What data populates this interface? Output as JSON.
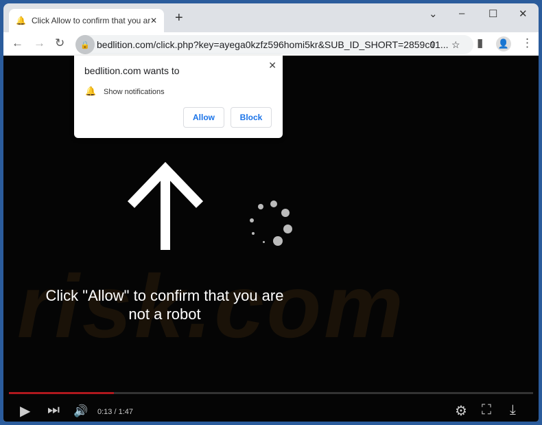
{
  "tab": {
    "title": "Click Allow to confirm that you are not a robot",
    "icon": "bell-favicon-icon"
  },
  "address": {
    "url": "bedlition.com/click.php?key=ayega0kzfz596homi5kr&SUB_ID_SHORT=2859c01..."
  },
  "popup": {
    "title": "bedlition.com wants to",
    "permission": "Show notifications",
    "allow": "Allow",
    "block": "Block"
  },
  "page": {
    "message": "Click \"Allow\" to confirm that you are not a robot",
    "watermark": "risk.com"
  },
  "video": {
    "time": "0:13 / 1:47",
    "played_fraction": 0.2,
    "accent": "#b0181e"
  }
}
